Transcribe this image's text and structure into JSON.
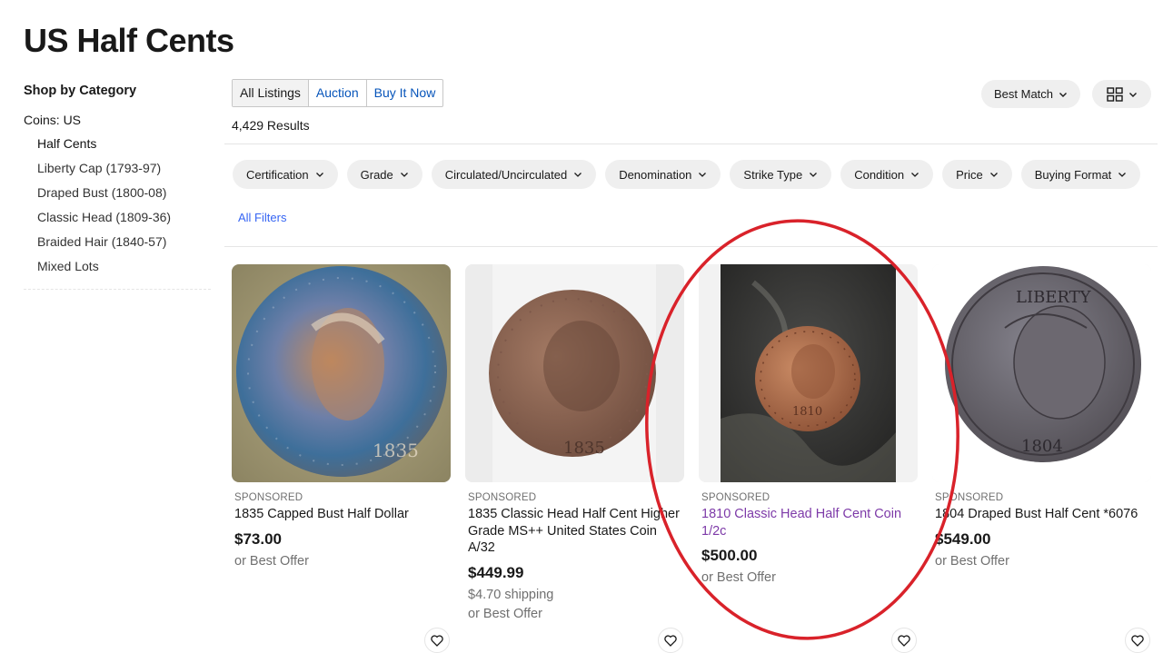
{
  "page": {
    "title": "US Half Cents"
  },
  "sidebar": {
    "heading": "Shop by Category",
    "parent": "Coins: US",
    "items": [
      {
        "label": "Half Cents"
      },
      {
        "label": "Liberty Cap (1793-97)"
      },
      {
        "label": "Draped Bust (1800-08)"
      },
      {
        "label": "Classic Head (1809-36)"
      },
      {
        "label": "Braided Hair (1840-57)"
      },
      {
        "label": "Mixed Lots"
      }
    ]
  },
  "tabs": [
    {
      "label": "All Listings",
      "active": true
    },
    {
      "label": "Auction"
    },
    {
      "label": "Buy It Now"
    }
  ],
  "results": {
    "count_text": "4,429 Results"
  },
  "sort": {
    "label": "Best Match",
    "icon": "chevron-down-icon"
  },
  "view": {
    "icon": "grid-view-icon"
  },
  "filters": [
    {
      "label": "Certification"
    },
    {
      "label": "Grade"
    },
    {
      "label": "Circulated/Uncirculated"
    },
    {
      "label": "Denomination"
    },
    {
      "label": "Strike Type"
    },
    {
      "label": "Condition"
    },
    {
      "label": "Price"
    },
    {
      "label": "Buying Format"
    }
  ],
  "all_filters": {
    "label": "All Filters"
  },
  "listings": [
    {
      "badge": "SPONSORED",
      "title": "1835 Capped Bust Half Dollar",
      "price": "$73.00",
      "offer": "or Best Offer"
    },
    {
      "badge": "SPONSORED",
      "title": "1835 Classic Head Half Cent Higher Grade MS++ United States Coin A/32",
      "price": "$449.99",
      "shipping": "$4.70 shipping",
      "offer": "or Best Offer"
    },
    {
      "badge": "SPONSORED",
      "title": "1810 Classic Head Half Cent Coin 1/2c",
      "price": "$500.00",
      "offer": "or Best Offer"
    },
    {
      "badge": "SPONSORED",
      "title": "1804 Draped Bust Half Cent *6076",
      "price": "$549.00",
      "offer": "or Best Offer"
    }
  ],
  "coin_dates": [
    "1835",
    "1835",
    "1810",
    "1804"
  ],
  "coin_legend": "LIBERTY",
  "colors": {
    "link": "#3665f3",
    "visited": "#7d3aa8",
    "annotation": "#d9222a",
    "chip_bg": "#efefef"
  }
}
